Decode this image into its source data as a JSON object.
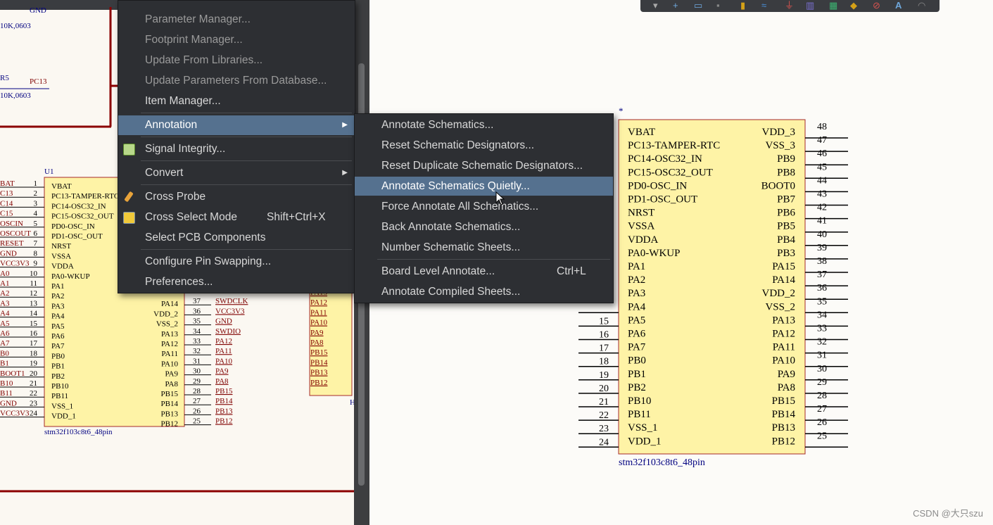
{
  "left_schematic": {
    "top_parts": [
      {
        "value": "10K,0603",
        "label": "GND"
      },
      {
        "designator": "R5",
        "value": "10K,0603",
        "net": "PC13"
      }
    ],
    "chip_designator": "U1",
    "chip_name": "stm32f103c8t6_48pin",
    "left_pins": [
      "VBAT",
      "PC13-TAMPER-RTC",
      "PC14-OSC32_IN",
      "PC15-OSC32_OUT",
      "PD0-OSC_IN",
      "PD1-OSC_OUT",
      "NRST",
      "VSSA",
      "VDDA",
      "PA0-WKUP",
      "PA1",
      "PA2",
      "PA3",
      "PA4",
      "PA5",
      "PA6",
      "PA7",
      "PB0",
      "PB1",
      "PB2",
      "PB10",
      "PB11",
      "VSS_1",
      "VDD_1"
    ],
    "left_pin_numbers": [
      "1",
      "2",
      "3",
      "4",
      "5",
      "6",
      "7",
      "8",
      "9",
      "10",
      "11",
      "12",
      "13",
      "14",
      "15",
      "16",
      "17",
      "18",
      "19",
      "20",
      "21",
      "22",
      "23",
      "24"
    ],
    "left_nets": [
      "BAT",
      "C13",
      "C14",
      "C15",
      "OSCIN",
      "OSCOUT",
      "RESET",
      "GND",
      "VCC3V3",
      "A0",
      "A1",
      "A2",
      "A3",
      "A4",
      "A5",
      "A6",
      "A7",
      "B0",
      "B1",
      "BOOT1",
      "B10",
      "B11",
      "GND",
      "VCC3V3"
    ],
    "right_pins": [
      "PA14",
      "VDD_2",
      "VSS_2",
      "PA13",
      "PA12",
      "PA11",
      "PA10",
      "PA9",
      "PA8",
      "PB15",
      "PB14",
      "PB13",
      "PB12"
    ],
    "right_pin_numbers": [
      "37",
      "36",
      "35",
      "34",
      "33",
      "32",
      "31",
      "30",
      "29",
      "28",
      "27",
      "26",
      "25"
    ],
    "right_nets": [
      "SWDCLK",
      "VCC3V3",
      "GND",
      "SWDIO",
      "PA12",
      "PA11",
      "PA10",
      "PA9",
      "PA8",
      "PB15",
      "PB14",
      "PB13",
      "PB12"
    ],
    "far_nets": [
      "PA13",
      "PA12",
      "PA11",
      "PA10",
      "PA9",
      "PA8",
      "PB15",
      "PB14",
      "PB13",
      "PB12"
    ],
    "far_label": "H"
  },
  "right_schematic": {
    "marker": "*",
    "chip_name": "stm32f103c8t6_48pin",
    "left_pins": [
      "VBAT",
      "PC13-TAMPER-RTC",
      "PC14-OSC32_IN",
      "PC15-OSC32_OUT",
      "PD0-OSC_IN",
      "PD1-OSC_OUT",
      "NRST",
      "VSSA",
      "VDDA",
      "PA0-WKUP",
      "PA1",
      "PA2",
      "PA3",
      "PA4",
      "PA5",
      "PA6",
      "PA7",
      "PB0",
      "PB1",
      "PB2",
      "PB10",
      "PB11",
      "VSS_1",
      "VDD_1"
    ],
    "left_pin_numbers_visible": [
      "15",
      "16",
      "17",
      "18",
      "19",
      "20",
      "21",
      "22",
      "23",
      "24"
    ],
    "right_pins": [
      "VDD_3",
      "VSS_3",
      "PB9",
      "PB8",
      "BOOT0",
      "PB7",
      "PB6",
      "PB5",
      "PB4",
      "PB3",
      "PA15",
      "PA14",
      "VDD_2",
      "VSS_2",
      "PA13",
      "PA12",
      "PA11",
      "PA10",
      "PA9",
      "PA8",
      "PB15",
      "PB14",
      "PB13",
      "PB12"
    ],
    "right_pin_numbers": [
      "48",
      "47",
      "46",
      "45",
      "44",
      "43",
      "42",
      "41",
      "40",
      "39",
      "38",
      "37",
      "36",
      "35",
      "34",
      "33",
      "32",
      "31",
      "30",
      "29",
      "28",
      "27",
      "26",
      "25"
    ]
  },
  "context_menu": {
    "items": [
      {
        "label": "Parameter Manager...",
        "type": "item"
      },
      {
        "label": "Footprint Manager...",
        "type": "item"
      },
      {
        "label": "Update From Libraries...",
        "type": "item"
      },
      {
        "label": "Update Parameters From Database...",
        "type": "item"
      },
      {
        "label": "Item Manager...",
        "type": "item"
      },
      {
        "label": "Annotation",
        "type": "submenu",
        "highlighted": true
      },
      {
        "label": "Signal Integrity...",
        "type": "item",
        "icon": "signal-integrity-icon"
      },
      {
        "label": "Convert",
        "type": "submenu"
      },
      {
        "label": "Cross Probe",
        "type": "item",
        "icon": "cross-probe-icon"
      },
      {
        "label": "Cross Select Mode",
        "shortcut": "Shift+Ctrl+X",
        "type": "item",
        "icon": "cross-select-icon"
      },
      {
        "label": "Select PCB Components",
        "type": "item"
      },
      {
        "label": "Configure Pin Swapping...",
        "type": "item"
      },
      {
        "label": "Preferences...",
        "type": "item"
      }
    ]
  },
  "annotation_submenu": {
    "items": [
      {
        "label": "Annotate Schematics..."
      },
      {
        "label": "Reset Schematic Designators..."
      },
      {
        "label": "Reset Duplicate Schematic Designators..."
      },
      {
        "label": "Annotate Schematics Quietly...",
        "highlighted": true
      },
      {
        "label": "Force Annotate All Schematics..."
      },
      {
        "label": "Back Annotate Schematics..."
      },
      {
        "label": "Number Schematic Sheets..."
      },
      {
        "label": "Board Level Annotate...",
        "shortcut": "Ctrl+L"
      },
      {
        "label": "Annotate Compiled Sheets..."
      }
    ]
  },
  "watermark": "CSDN @大只szu",
  "colors": {
    "menu_bg": "#2d2f33",
    "menu_highlight": "#55718f",
    "chip_fill": "#fef3a6",
    "chip_border": "#a52a2a",
    "wire": "#8b0000",
    "pin_text": "#000000",
    "net_text": "#800000",
    "designator_text": "#000080"
  }
}
